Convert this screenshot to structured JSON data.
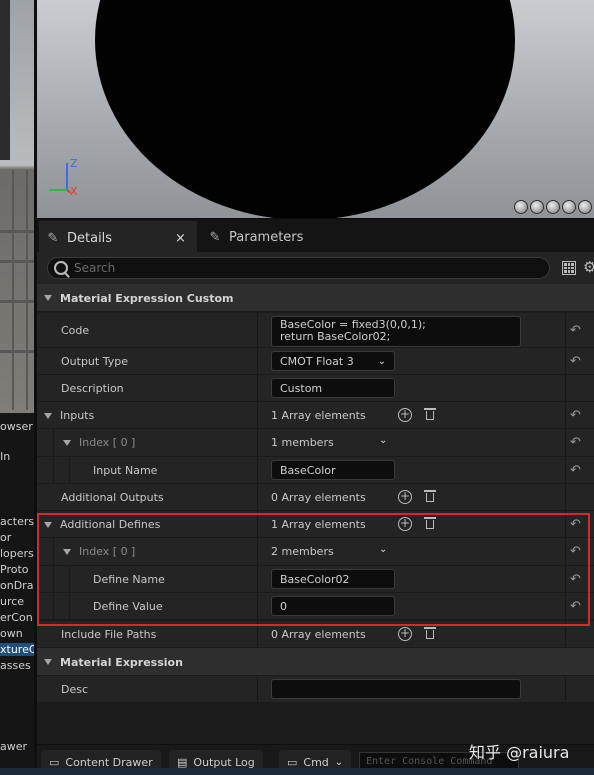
{
  "left_panel": {
    "items": [
      "owser",
      "In",
      "acters",
      "or",
      "lopers",
      "Proto",
      "onDra",
      "urce",
      "erCon",
      "xtureC",
      "own",
      "asses",
      "awer"
    ]
  },
  "viewport": {
    "axis_z": "Z",
    "axis_x": "X"
  },
  "tabs": {
    "details": "Details",
    "details_close": "×",
    "parameters": "Parameters"
  },
  "search": {
    "placeholder": "Search"
  },
  "details": {
    "cat_custom": "Material Expression Custom",
    "code_label": "Code",
    "code_line1": "BaseColor = fixed3(0,0,1);",
    "code_line2": "return BaseColor02;",
    "output_type_label": "Output Type",
    "output_type_value": "CMOT Float 3",
    "description_label": "Description",
    "description_value": "Custom",
    "inputs_label": "Inputs",
    "inputs_value": "1 Array elements",
    "inputs_index_label": "Index [ 0 ]",
    "inputs_index_value": "1 members",
    "input_name_label": "Input Name",
    "input_name_value": "BaseColor",
    "additional_outputs_label": "Additional Outputs",
    "additional_outputs_value": "0 Array elements",
    "additional_defines_label": "Additional Defines",
    "additional_defines_value": "1 Array elements",
    "defines_index_label": "Index [ 0 ]",
    "defines_index_value": "2 members",
    "define_name_label": "Define Name",
    "define_name_value": "BaseColor02",
    "define_value_label": "Define Value",
    "define_value_value": "0",
    "include_paths_label": "Include File Paths",
    "include_paths_value": "0 Array elements",
    "cat_expression": "Material Expression",
    "desc_label": "Desc",
    "desc_value": ""
  },
  "bottom": {
    "content_drawer": "Content Drawer",
    "output_log": "Output Log",
    "cmd": "Cmd",
    "console_placeholder": "Enter Console Command",
    "watermark": "知乎 @raiura"
  },
  "colors": {
    "highlight": "#d9262b",
    "selection": "#1d4e7e"
  }
}
